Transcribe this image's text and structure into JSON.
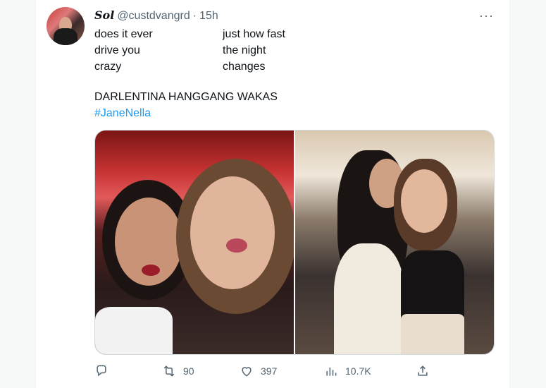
{
  "tweet": {
    "author_name": "Sol",
    "author_handle": "@custdvangrd",
    "separator": "·",
    "time": "15h",
    "more_label": "···",
    "text_left": [
      "does it ever",
      "drive you",
      "crazy"
    ],
    "text_right": [
      "just how fast",
      "the night",
      "changes"
    ],
    "text_caption": "DARLENTINA HANGGANG WAKAS",
    "hashtag": "#JaneNella"
  },
  "actions": {
    "reply_count": "",
    "retweet_count": "90",
    "like_count": "397",
    "views_count": "10.7K"
  },
  "icons": {
    "reply": "reply-icon",
    "retweet": "retweet-icon",
    "like": "heart-icon",
    "views": "views-chart-icon",
    "share": "share-icon"
  },
  "colors": {
    "link": "#1d9bf0",
    "secondary_text": "#536471",
    "primary_text": "#0f1419"
  }
}
